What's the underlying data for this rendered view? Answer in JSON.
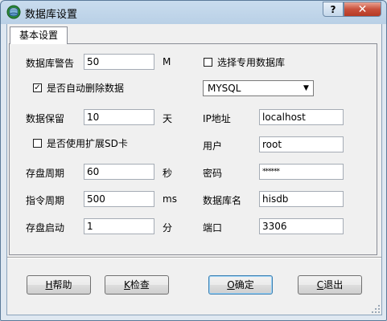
{
  "window": {
    "title": "数据库设置",
    "help_glyph": "?",
    "close_glyph": "✕"
  },
  "tabs": [
    {
      "label": "基本设置",
      "selected": true
    }
  ],
  "left": {
    "db_warning_label": "数据库警告",
    "db_warning_value": "50",
    "db_warning_unit": "M",
    "auto_delete_label": "是否自动删除数据",
    "auto_delete_checked": true,
    "retain_label": "数据保留",
    "retain_value": "10",
    "retain_unit": "天",
    "sd_label": "是否使用扩展SD卡",
    "sd_checked": false,
    "save_period_label": "存盘周期",
    "save_period_value": "60",
    "save_period_unit": "秒",
    "cmd_period_label": "指令周期",
    "cmd_period_value": "500",
    "cmd_period_unit": "ms",
    "save_start_label": "存盘启动",
    "save_start_value": "1",
    "save_start_unit": "分"
  },
  "right": {
    "dedicated_db_label": "选择专用数据库",
    "dedicated_db_checked": false,
    "db_type_selected": "MYSQL",
    "ip_label": "IP地址",
    "ip_value": "localhost",
    "user_label": "用户",
    "user_value": "root",
    "password_label": "密码",
    "password_value": "******",
    "dbname_label": "数据库名",
    "dbname_value": "hisdb",
    "port_label": "端口",
    "port_value": "3306"
  },
  "buttons": {
    "help_key": "H",
    "help_text": "帮助",
    "check_key": "K",
    "check_text": "检查",
    "ok_key": "O",
    "ok_text": "确定",
    "cancel_key": "C",
    "cancel_text": "退出"
  },
  "colors": {
    "title_bar": "#b9d0e6",
    "client_bg": "#f0f0f0",
    "close_button": "#c9503c"
  }
}
